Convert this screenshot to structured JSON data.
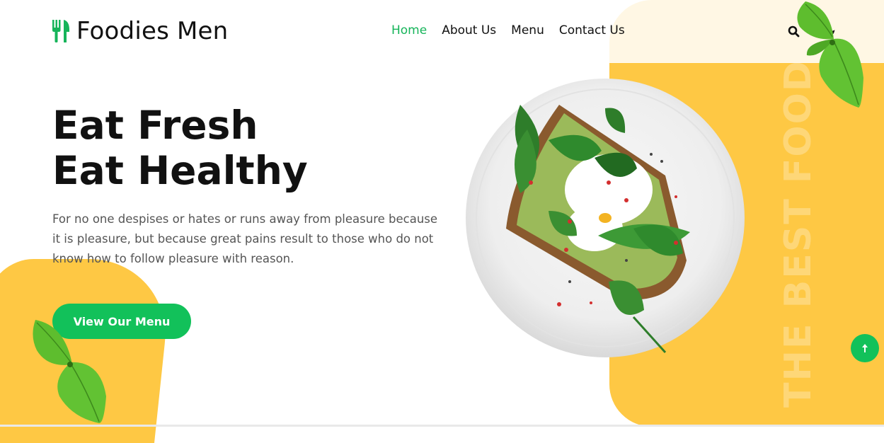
{
  "brand": {
    "name": "Foodies Men",
    "icon": "fork-knife-icon",
    "accent": "#16b45a"
  },
  "nav": {
    "items": [
      {
        "label": "Home",
        "active": true
      },
      {
        "label": "About Us",
        "active": false
      },
      {
        "label": "Menu",
        "active": false
      },
      {
        "label": "Contact Us",
        "active": false
      }
    ],
    "icons": [
      "search-icon",
      "moon-icon"
    ]
  },
  "hero": {
    "title_line1": "Eat Fresh",
    "title_line2": "Eat Healthy",
    "description": "For no one despises or hates or runs away from pleasure because it is pleasure, but because great pains result to those who do not know how to follow pleasure with reason.",
    "cta_label": "View Our Menu",
    "side_text": "THE BEST FOOD"
  },
  "colors": {
    "yellow": "#fec844",
    "green": "#12c15a",
    "text": "#111111",
    "muted": "#555555"
  },
  "scroll_top": {
    "icon": "arrow-up-icon"
  }
}
